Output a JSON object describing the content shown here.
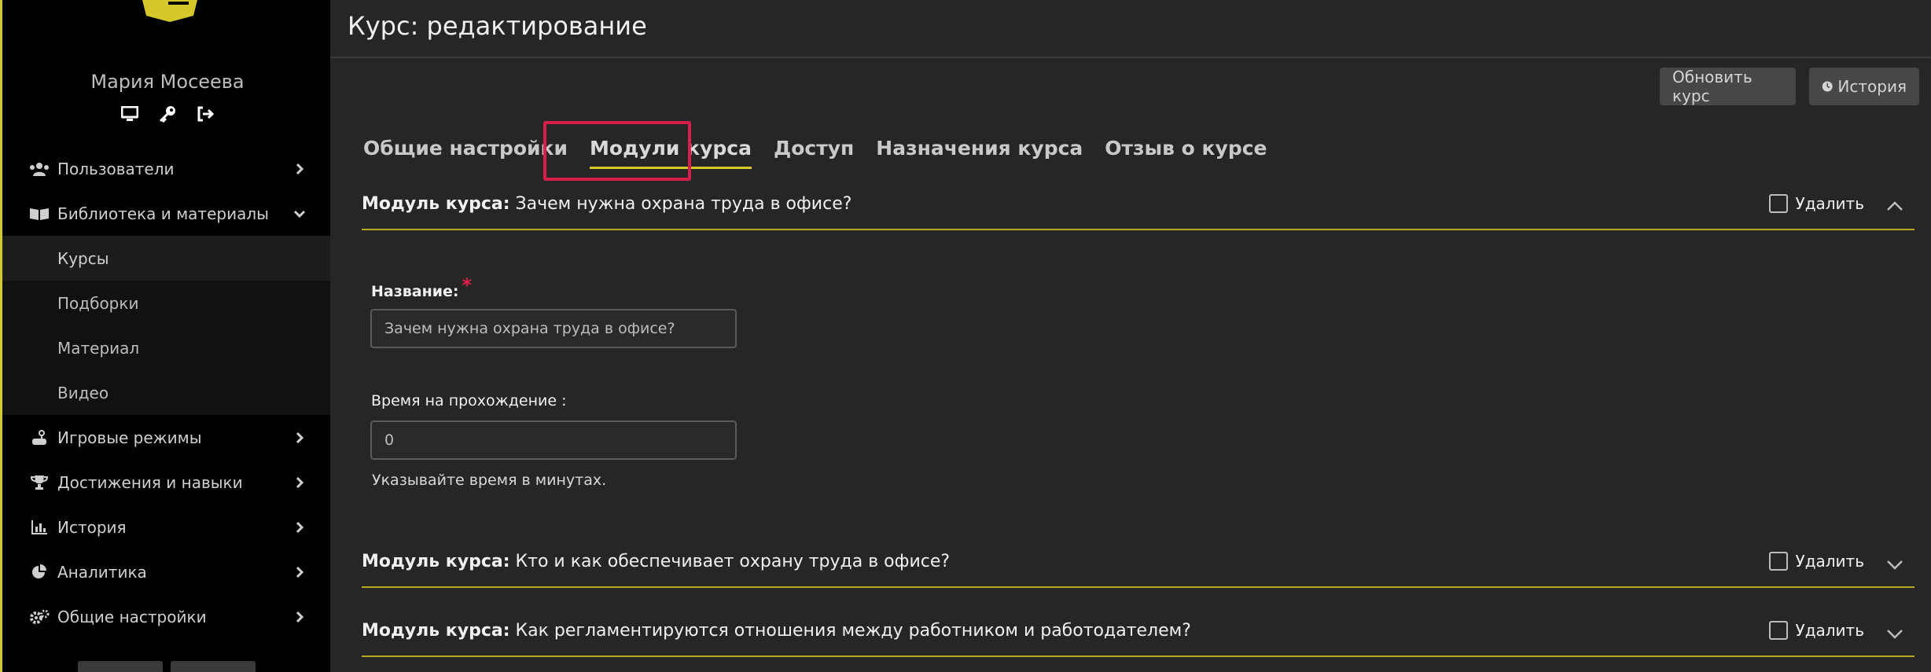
{
  "sidebar": {
    "user_name": "Мария Мосеева",
    "user_icons": [
      "monitor-icon",
      "key-icon",
      "sign-out-icon"
    ],
    "items": [
      {
        "label": "Пользователи",
        "icon": "users-icon"
      },
      {
        "label": "Библиотека и материалы",
        "icon": "book-icon",
        "expanded": true
      },
      {
        "label": "Игровые режимы",
        "icon": "gamepad-icon"
      },
      {
        "label": "Достижения и навыки",
        "icon": "trophy-icon"
      },
      {
        "label": "История",
        "icon": "chart-icon"
      },
      {
        "label": "Аналитика",
        "icon": "pie-icon"
      },
      {
        "label": "Общие настройки",
        "icon": "cogs-icon"
      }
    ],
    "sub_items": [
      {
        "label": "Курсы",
        "active": true
      },
      {
        "label": "Подборки"
      },
      {
        "label": "Материал"
      },
      {
        "label": "Видео"
      }
    ]
  },
  "header": {
    "title": "Курс: редактирование",
    "update_button": "Обновить курс",
    "history_button": "История"
  },
  "tabs": [
    {
      "label": "Общие настройки"
    },
    {
      "label": "Модули курса",
      "active": true
    },
    {
      "label": "Доступ"
    },
    {
      "label": "Назначения курса"
    },
    {
      "label": "Отзыв о курсе"
    }
  ],
  "modules": [
    {
      "prefix": "Модуль курса:",
      "title": "Зачем нужна охрана труда в офисе?",
      "delete_label": "Удалить",
      "expanded": true
    },
    {
      "prefix": "Модуль курса:",
      "title": "Кто и как обеспечивает охрану труда в офисе?",
      "delete_label": "Удалить",
      "expanded": false
    },
    {
      "prefix": "Модуль курса:",
      "title": "Как регламентируются отношения между работником и работодателем?",
      "delete_label": "Удалить",
      "expanded": false
    }
  ],
  "form": {
    "name_label": "Название:",
    "required_mark": "*",
    "name_value": "Зачем нужна охрана труда в офисе?",
    "time_label": "Время на прохождение :",
    "time_value": "0",
    "time_hint": "Указывайте время в минутах."
  },
  "colors": {
    "accent": "#d6c72a",
    "highlight": "#d81f4a",
    "sidebar_bg": "#000000",
    "main_bg": "#262626"
  }
}
